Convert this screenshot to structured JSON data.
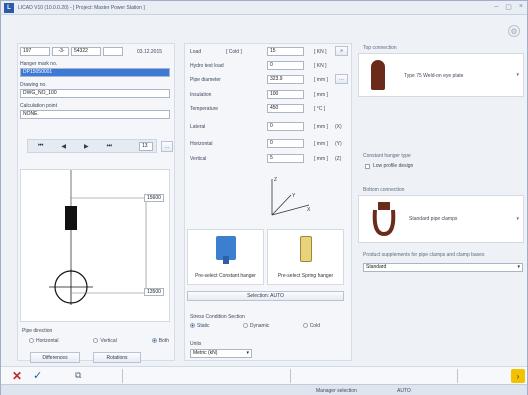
{
  "window": {
    "title": "LICAD V10 (10.0.0.20) - [ Project: Master Power Station ]",
    "logo_letter": "L"
  },
  "left": {
    "row1": [
      "197",
      "-3-",
      "54322",
      "",
      "03.12.2015"
    ],
    "hanger_mark_label": "Hanger mark no.",
    "hanger_mark_value": "DP15050001",
    "drawing_label": "Drawing no.",
    "drawing_value": "DWG_NO_100",
    "calc_label": "Calculation point",
    "calc_value": "NONE",
    "page_number": "13",
    "dim_top": "15600",
    "dim_bottom": "13500",
    "pipe_direction_label": "Pipe direction",
    "pipe_direction_options": [
      "Horizontal",
      "Vertical",
      "Both"
    ],
    "differences_label": "Differences",
    "rotations_label": "Rotations"
  },
  "middle": {
    "fields": [
      {
        "label": "Load",
        "sub": "[ Cold ]",
        "value": "15",
        "unit": "[ KN ]",
        "extra": ""
      },
      {
        "label": "Hydro test load",
        "sub": "",
        "value": "0",
        "unit": "[ KN ]",
        "extra": ""
      },
      {
        "label": "Pipe diameter",
        "sub": "",
        "value": "323.9",
        "unit": "[ mm ]",
        "extra": ""
      },
      {
        "label": "Insulation",
        "sub": "",
        "value": "100",
        "unit": "[ mm ]",
        "extra": ""
      },
      {
        "label": "Temperature",
        "sub": "",
        "value": "450",
        "unit": "[ °C ]",
        "extra": ""
      },
      {
        "label": "Lateral",
        "sub": "",
        "value": "0",
        "unit": "[ mm ]",
        "extra": "(X)"
      },
      {
        "label": "Horizontal",
        "sub": "",
        "value": "0",
        "unit": "[ mm ]",
        "extra": "(Y)"
      },
      {
        "label": "Vertical",
        "sub": "",
        "value": "5",
        "unit": "[ mm ]",
        "extra": "(Z)"
      }
    ],
    "axis_z": "Z",
    "axis_y": "Y",
    "axis_x": "X",
    "preselect_constant": "Pre-select Constant hanger",
    "preselect_spring": "Pre-select Spring hanger",
    "selection": "Selection: AUTO",
    "stress_label": "Stress Condition Section",
    "stress_options": [
      "Static",
      "Dynamic",
      "Cold"
    ],
    "units_label": "Units",
    "units_value": "Metric (kN)"
  },
  "right": {
    "top_connection_label": "Top connection",
    "top_connection_value": "Type 75 Weld-on eye plate",
    "constant_type_label": "Constant hanger type",
    "low_profile_label": "Low profile design",
    "bottom_connection_label": "Bottom connection",
    "bottom_connection_value": "Standard pipe clamps",
    "supplements_label": "Product supplements for pipe clamps and clamp bases",
    "supplements_value": "Standard"
  },
  "status": {
    "manager_selection_label": "Manager selection",
    "manager_selection_value": "AUTO"
  },
  "colors": {
    "accent": "#2a5aa8",
    "close_red": "#c62828",
    "next_yellow": "#f2c200",
    "selected_bg": "#3d7ad6",
    "part_brown": "#6b2b1b"
  }
}
